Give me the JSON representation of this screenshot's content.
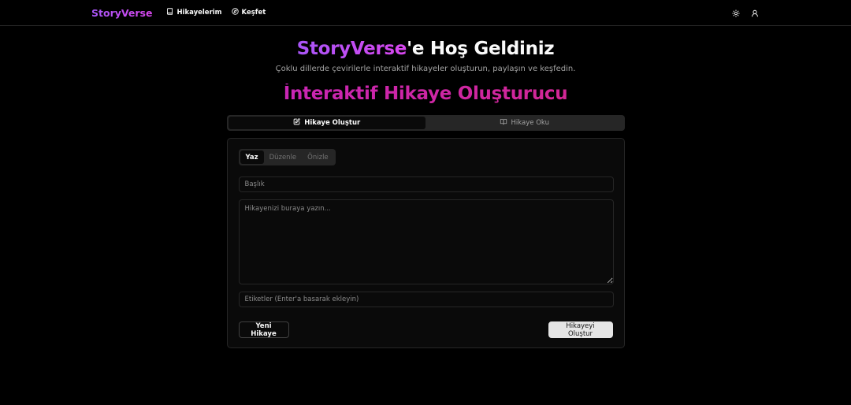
{
  "navbar": {
    "brand": "StoryVerse",
    "links": [
      {
        "label": "Hikayelerim",
        "icon": "book-icon"
      },
      {
        "label": "Keşfet",
        "icon": "compass-icon"
      }
    ],
    "right_icons": [
      "sun-icon",
      "user-icon"
    ]
  },
  "hero": {
    "title_brand": "StoryVerse",
    "title_rest": "'e Hoş Geldiniz",
    "subtitle": "Çoklu dillerde çevirilerle interaktif hikayeler oluşturun, paylaşın ve keşfedin."
  },
  "section_title": "İnteraktif Hikaye Oluşturucu",
  "tabs": [
    {
      "label": "Hikaye Oluştur",
      "icon": "edit-icon",
      "active": true
    },
    {
      "label": "Hikaye Oku",
      "icon": "open-book-icon",
      "active": false
    }
  ],
  "editor": {
    "modes": [
      {
        "label": "Yaz",
        "active": true
      },
      {
        "label": "Düzenle",
        "active": false
      },
      {
        "label": "Önizle",
        "active": false
      }
    ],
    "title_placeholder": "Başlık",
    "story_placeholder": "Hikayenizi buraya yazın...",
    "tags_placeholder": "Etiketler (Enter'a basarak ekleyin)",
    "new_story_label": "Yeni Hikaye",
    "create_label": "Hikayeyi Oluştur"
  },
  "colors": {
    "background": "#000000",
    "brand_gradient": [
      "#a855f7",
      "#d946ef"
    ],
    "section_gradient": [
      "#c026d3",
      "#db2777"
    ]
  }
}
